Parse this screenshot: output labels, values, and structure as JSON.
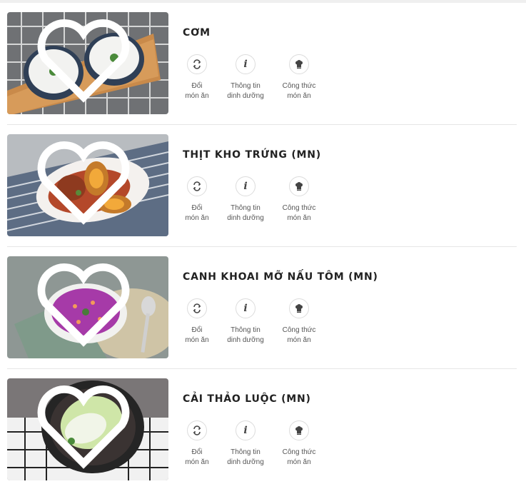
{
  "dishes": [
    {
      "name": "CƠM",
      "actions": [
        {
          "line1": "Đổi",
          "line2": "món ăn",
          "icon": "swap-icon"
        },
        {
          "line1": "Thông tin",
          "line2": "dinh dưỡng",
          "icon": "info-icon"
        },
        {
          "line1": "Công thức",
          "line2": "món ăn",
          "icon": "chef-hat-icon"
        }
      ]
    },
    {
      "name": "THỊT KHO TRỨNG (MN)",
      "actions": [
        {
          "line1": "Đổi",
          "line2": "món ăn",
          "icon": "swap-icon"
        },
        {
          "line1": "Thông tin",
          "line2": "dinh dưỡng",
          "icon": "info-icon"
        },
        {
          "line1": "Công thức",
          "line2": "món ăn",
          "icon": "chef-hat-icon"
        }
      ]
    },
    {
      "name": "CANH KHOAI MỠ NẤU TÔM (MN)",
      "actions": [
        {
          "line1": "Đổi",
          "line2": "món ăn",
          "icon": "swap-icon"
        },
        {
          "line1": "Thông tin",
          "line2": "dinh dưỡng",
          "icon": "info-icon"
        },
        {
          "line1": "Công thức",
          "line2": "món ăn",
          "icon": "chef-hat-icon"
        }
      ]
    },
    {
      "name": "CẢI THẢO LUỘC (MN)",
      "actions": [
        {
          "line1": "Đổi",
          "line2": "món ăn",
          "icon": "swap-icon"
        },
        {
          "line1": "Thông tin",
          "line2": "dinh dưỡng",
          "icon": "info-icon"
        },
        {
          "line1": "Công thức",
          "line2": "món ăn",
          "icon": "chef-hat-icon"
        }
      ]
    }
  ]
}
